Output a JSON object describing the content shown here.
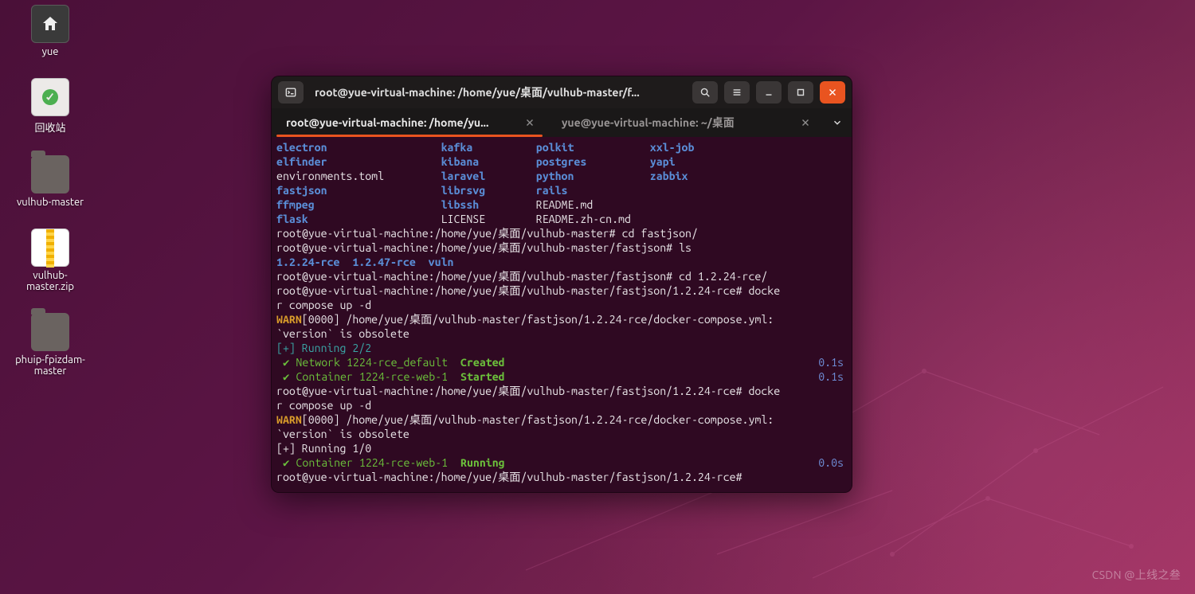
{
  "desktop": {
    "icons": [
      {
        "id": "home",
        "label": "yue"
      },
      {
        "id": "trash",
        "label": "回收站"
      },
      {
        "id": "folder1",
        "label": "vulhub-master"
      },
      {
        "id": "zip",
        "label": "vulhub-\nmaster.zip"
      },
      {
        "id": "folder2",
        "label": "phuip-fpizdam-\nmaster"
      }
    ]
  },
  "window": {
    "title": "root@yue-virtual-machine: /home/yue/桌面/vulhub-master/f...",
    "tabs": [
      {
        "label": "root@yue-virtual-machine: /home/yu...",
        "active": true
      },
      {
        "label": "yue@yue-virtual-machine: ~/桌面",
        "active": false
      }
    ]
  },
  "terminal": {
    "ls_cols": [
      [
        "electron",
        "elfinder",
        "environments.toml",
        "fastjson",
        "ffmpeg",
        "flask"
      ],
      [
        "kafka",
        "kibana",
        "laravel",
        "librsvg",
        "libssh",
        "LICENSE"
      ],
      [
        "polkit",
        "postgres",
        "python",
        "rails",
        "README.md",
        "README.zh-cn.md"
      ],
      [
        "xxl-job",
        "yapi",
        "zabbix",
        "",
        "",
        ""
      ]
    ],
    "ls_types": [
      [
        "dir",
        "dir",
        "file",
        "dir",
        "dir",
        "dir"
      ],
      [
        "dir",
        "dir",
        "dir",
        "dir",
        "dir",
        "file"
      ],
      [
        "dir",
        "dir",
        "dir",
        "dir",
        "file",
        "file"
      ],
      [
        "dir",
        "dir",
        "dir",
        "",
        "",
        ""
      ]
    ],
    "prompt1": "root@yue-virtual-machine:/home/yue/桌面/vulhub-master#",
    "cmd1": "cd fastjson/",
    "prompt2": "root@yue-virtual-machine:/home/yue/桌面/vulhub-master/fastjson#",
    "cmd2": "ls",
    "ls2": "1.2.24-rce  1.2.47-rce  vuln",
    "prompt3": "root@yue-virtual-machine:/home/yue/桌面/vulhub-master/fastjson#",
    "cmd3": "cd 1.2.24-rce/",
    "prompt4": "root@yue-virtual-machine:/home/yue/桌面/vulhub-master/fastjson/1.2.24-rce#",
    "cmd4a": "docke",
    "cmd4b": "r compose up -d",
    "warn_tag": "WARN",
    "warn_body": "[0000] /home/yue/桌面/vulhub-master/fastjson/1.2.24-rce/docker-compose.yml:",
    "warn_body2": "`version` is obsolete",
    "run1": "[+] Running 2/2",
    "svc1_left": " ✔ Network 1224-rce_default  ",
    "svc1_status": "Created",
    "svc1_time": "0.1s",
    "svc2_left": " ✔ Container 1224-rce-web-1  ",
    "svc2_status": "Started",
    "svc2_time": "0.1s",
    "prompt5": "root@yue-virtual-machine:/home/yue/桌面/vulhub-master/fastjson/1.2.24-rce#",
    "cmd5a": "docke",
    "cmd5b": "r compose up -d",
    "run2": "[+] Running 1/0",
    "svc3_left": " ✔ Container 1224-rce-web-1  ",
    "svc3_status": "Running",
    "svc3_time": "0.0s",
    "prompt6": "root@yue-virtual-machine:/home/yue/桌面/vulhub-master/fastjson/1.2.24-rce#"
  },
  "watermark": "CSDN @上线之叁"
}
